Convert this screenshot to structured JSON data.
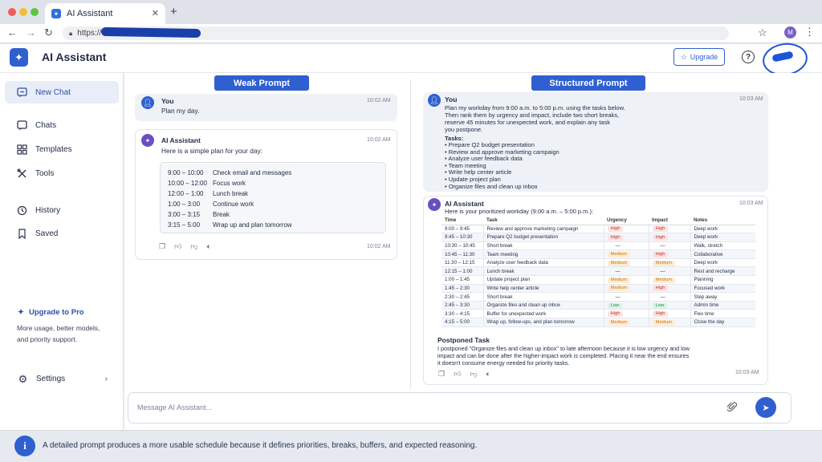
{
  "browser": {
    "tab_title": "AI Assistant",
    "url_prefix": "https://",
    "avatar_initial": "M"
  },
  "header": {
    "app_title": "AI Assistant",
    "upgrade_label": "Upgrade"
  },
  "sidebar": {
    "items": [
      {
        "label": "New Chat",
        "icon": "chat-plus-icon"
      },
      {
        "label": "Chats",
        "icon": "chat-icon"
      },
      {
        "label": "Templates",
        "icon": "grid-icon"
      },
      {
        "label": "Tools",
        "icon": "tools-icon"
      },
      {
        "label": "History",
        "icon": "history-icon"
      },
      {
        "label": "Saved",
        "icon": "bookmark-icon"
      }
    ],
    "promo_title": "Upgrade to Pro",
    "promo_line1": "More usage, better models,",
    "promo_line2": "and priority support.",
    "settings_label": "Settings"
  },
  "weak": {
    "title": "Weak Prompt",
    "user_name": "You",
    "user_time": "10:02 AM",
    "user_text": "Plan my day.",
    "ai_name": "AI Assistant",
    "ai_time": "10:02 AM",
    "ai_intro": "Here is a simple plan for your day:",
    "plan": [
      {
        "time": "9:00 – 10:00",
        "task": "Check email and messages"
      },
      {
        "time": "10:00 – 12:00",
        "task": "Focus work"
      },
      {
        "time": "12:00 – 1:00",
        "task": "Lunch break"
      },
      {
        "time": "1:00 – 3:00",
        "task": "Continue work"
      },
      {
        "time": "3:00 – 3:15",
        "task": "Break"
      },
      {
        "time": "3:15 – 5:00",
        "task": "Wrap up and plan tomorrow"
      }
    ],
    "footer_time": "10:02 AM"
  },
  "structured": {
    "title": "Structured Prompt",
    "user_name": "You",
    "user_time": "10:03 AM",
    "user_lines": [
      "Plan my workday from 9:00 a.m. to 5:00 p.m. using the tasks below.",
      "Then rank them by urgency and impact, include two short breaks,",
      "reserve 45 minutes for unexpected work, and explain any task",
      "you postpone."
    ],
    "tasks_label": "Tasks:",
    "tasks": [
      "• Prepare Q2 budget presentation",
      "• Review and approve marketing campaign",
      "• Analyze user feedback data",
      "• Team meeting",
      "• Write help center article",
      "• Update project plan",
      "• Organize files and clean up inbox"
    ],
    "ai_name": "AI Assistant",
    "ai_time": "10:03 AM",
    "ai_intro": "Here is your prioritized workday (9:00 a.m. – 5:00 p.m.):",
    "table_headers": [
      "Time",
      "Task",
      "Urgency",
      "Impact",
      "Notes"
    ],
    "table_rows": [
      [
        "9:00 – 9:45",
        "Review and approve marketing campaign",
        "High",
        "High",
        "Deep work"
      ],
      [
        "9:45 – 10:30",
        "Prepare Q2 budget presentation",
        "High",
        "High",
        "Deep work"
      ],
      [
        "10:30 – 10:45",
        "Short break",
        "—",
        "—",
        "Walk, stretch"
      ],
      [
        "10:45 – 11:30",
        "Team meeting",
        "Medium",
        "High",
        "Collaborative"
      ],
      [
        "11:30 – 12:15",
        "Analyze user feedback data",
        "Medium",
        "Medium",
        "Deep work"
      ],
      [
        "12:15 – 1:00",
        "Lunch break",
        "—",
        "—",
        "Rest and recharge"
      ],
      [
        "1:00 – 1:45",
        "Update project plan",
        "Medium",
        "Medium",
        "Planning"
      ],
      [
        "1:45 – 2:30",
        "Write help center article",
        "Medium",
        "High",
        "Focused work"
      ],
      [
        "2:30 – 2:45",
        "Short break",
        "—",
        "—",
        "Step away"
      ],
      [
        "2:45 – 3:30",
        "Organize files and clean up inbox",
        "Low",
        "Low",
        "Admin time"
      ],
      [
        "3:30 – 4:15",
        "Buffer for unexpected work",
        "High",
        "High",
        "Flex time"
      ],
      [
        "4:15 – 5:00",
        "Wrap up, follow-ups, and plan tomorrow",
        "Medium",
        "Medium",
        "Close the day"
      ]
    ],
    "postponed_title": "Postponed Task",
    "postponed_lines": [
      "I postponed \"Organize files and clean up inbox\" to late afternoon because it is low urgency and low",
      "impact and can be done after the higher-impact work is completed. Placing it near the end ensures",
      "it doesn't consume energy needed for priority tasks."
    ],
    "footer_time": "10:03 AM"
  },
  "composer": {
    "placeholder": "Message AI Assistant..."
  },
  "footer": {
    "text": "A detailed prompt produces a more usable schedule because it defines priorities, breaks, buffers, and expected reasoning."
  }
}
